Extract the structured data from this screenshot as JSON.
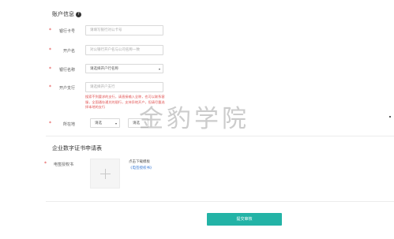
{
  "account_section": {
    "title": "账户信息",
    "help_glyph": "?"
  },
  "form": {
    "required_mark": "*",
    "card_number": {
      "label": "银行卡号",
      "placeholder": "请填写银行对公卡号"
    },
    "account_name": {
      "label": "开户名",
      "placeholder": "对公银行开户名与公司名称一致"
    },
    "bank_name": {
      "label": "银行名称",
      "value": "请选择开户行名称",
      "caret": "▾"
    },
    "branch": {
      "label": "开户支行",
      "placeholder": "请选择开户支行",
      "hint": "搜索不到要求的支行，请直接输入全称，也可以联系客服，全国通存通兑的银行，支持异地开户，但请尽量选择本地的支行"
    },
    "location": {
      "label": "所在地",
      "province": "请选",
      "city": "请选",
      "caret": "▾"
    }
  },
  "certificate_section": {
    "title": "企业数字证书申请表",
    "field_label": "电签授权书",
    "download_text": "点击下载模板",
    "download_link": "《电签授权书》"
  },
  "submit_button": {
    "label": "提交审核"
  },
  "watermark": {
    "text": "金豹学院"
  },
  "colors": {
    "accent": "#23b3a6",
    "required": "#e04040",
    "link": "#3a7bd5"
  }
}
